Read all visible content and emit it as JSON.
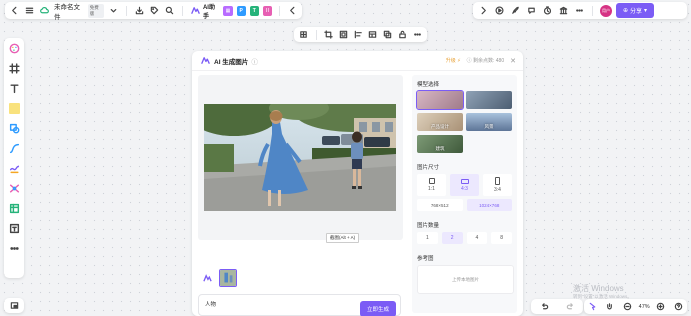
{
  "toolbar_left": {
    "file_title": "未命名文件",
    "plan_badge": "免费版",
    "ai_helper_label": "AI助手",
    "mini_apps": [
      {
        "icon": "image-app-icon",
        "color": "#b86bff",
        "label": ""
      },
      {
        "icon": "p-app-icon",
        "color": "#2e9bff",
        "label": "P"
      },
      {
        "icon": "t-app-icon",
        "color": "#26b37a",
        "label": "T"
      },
      {
        "icon": "grid-app-icon",
        "color": "#e75fb3",
        "label": "⁞⁞"
      }
    ]
  },
  "toolbar_right": {
    "avatar_text": "用户",
    "share_label": "分享"
  },
  "dialog": {
    "title": "AI 生成图片",
    "upgrade_label": "升级",
    "credits_label": "剩余点数: 480",
    "tooltip": "截图(Alt + A)",
    "prompt_value": "人物",
    "generate_label": "立即生成",
    "model_section": "模型选择",
    "models": [
      {
        "name": "anime",
        "label": "",
        "selected": true,
        "color": "#c9a3b8"
      },
      {
        "name": "ink",
        "label": "",
        "selected": false,
        "color": "#6a7d94"
      },
      {
        "name": "product-design",
        "label": "产品设计",
        "selected": false,
        "color": "#c9b49a"
      },
      {
        "name": "landscape",
        "label": "风景",
        "selected": false,
        "color": "#7d94b1"
      },
      {
        "name": "architecture",
        "label": "建筑",
        "selected": false,
        "color": "#5e7a5a"
      }
    ],
    "size_section": "图片尺寸",
    "sizes": [
      {
        "label": "1:1",
        "selected": false
      },
      {
        "label": "4:3",
        "selected": true
      },
      {
        "label": "3:4",
        "selected": false
      }
    ],
    "resolutions": [
      {
        "label": "768×512",
        "selected": false
      },
      {
        "label": "1024×768",
        "selected": true
      }
    ],
    "count_section": "图片数量",
    "counts": [
      {
        "label": "1",
        "selected": false
      },
      {
        "label": "2",
        "selected": true
      },
      {
        "label": "4",
        "selected": false
      },
      {
        "label": "8",
        "selected": false
      }
    ],
    "reference_section": "参考图",
    "upload_label": "上传本地图片"
  },
  "zoom": {
    "level": "47%"
  },
  "watermark": {
    "line1": "激活 Windows",
    "line2": "转到\"设置\"以激活 Windows。"
  }
}
